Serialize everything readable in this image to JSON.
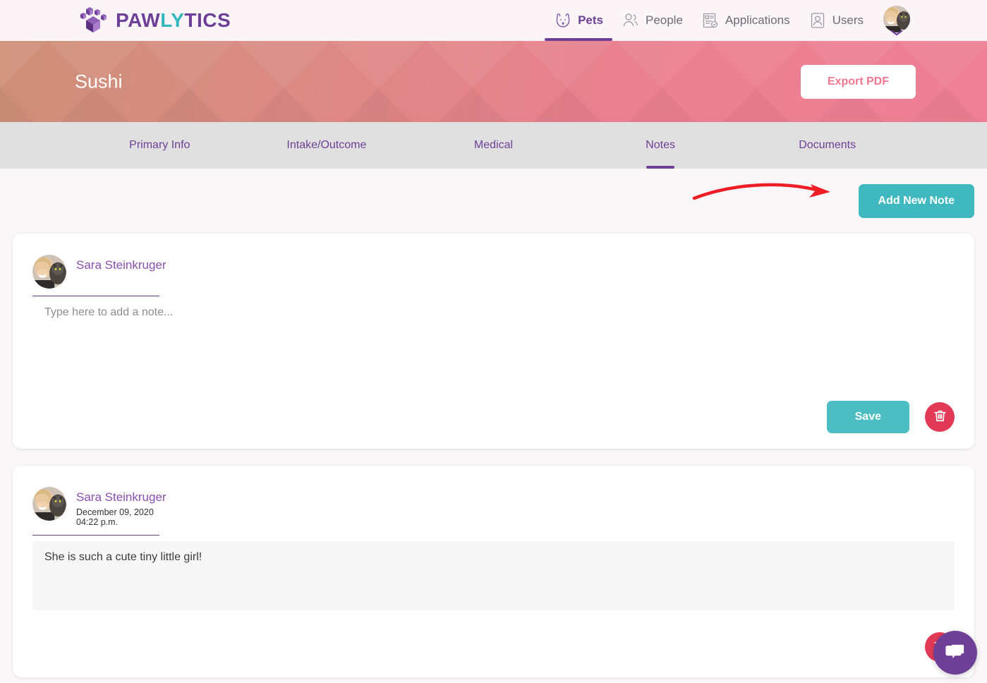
{
  "brand": {
    "name_part1": "PAW",
    "name_part2": "LY",
    "name_part3": "TICS",
    "logo_icon": "paw-print-cube-logo",
    "purple": "#6d3f96",
    "teal": "#35b6bd"
  },
  "nav": {
    "items": [
      {
        "label": "Pets",
        "icon": "dog-face-icon",
        "active": true
      },
      {
        "label": "People",
        "icon": "two-people-icon",
        "active": false
      },
      {
        "label": "Applications",
        "icon": "document-check-icon",
        "active": false
      },
      {
        "label": "Users",
        "icon": "user-badge-icon",
        "active": false
      }
    ],
    "avatar_icon": "user-avatar-photo",
    "dropdown_icon": "chevron-down-icon"
  },
  "banner": {
    "pet_name": "Sushi",
    "export_label": "Export PDF",
    "gradient_from": "#cd8f78",
    "gradient_to": "#ee7f96"
  },
  "tabs": {
    "items": [
      {
        "label": "Primary Info",
        "active": false
      },
      {
        "label": "Intake/Outcome",
        "active": false
      },
      {
        "label": "Medical",
        "active": false
      },
      {
        "label": "Notes",
        "active": true
      },
      {
        "label": "Documents",
        "active": false
      }
    ],
    "active_color": "#6d3f96"
  },
  "toolbar": {
    "add_note_label": "Add New Note",
    "add_note_color": "#3fb9bf",
    "annotation_arrow": {
      "icon": "curved-arrow-annotation",
      "color": "#ee1c25"
    }
  },
  "notes": [
    {
      "author": "Sara Steinkruger",
      "avatar_icon": "user-avatar-photo",
      "date": "",
      "time": "",
      "body": "",
      "placeholder": "Type here to add a note...",
      "editable": true,
      "save_label": "Save",
      "delete_icon": "trash-icon"
    },
    {
      "author": "Sara Steinkruger",
      "avatar_icon": "user-avatar-photo",
      "date": "December 09, 2020",
      "time": "04:22 p.m.",
      "body": "She is such a cute tiny little girl!",
      "placeholder": "",
      "editable": false,
      "save_label": "",
      "delete_icon": "trash-icon"
    }
  ],
  "chat_widget": {
    "icon": "chat-bubbles-icon",
    "color": "#6d3f96"
  }
}
